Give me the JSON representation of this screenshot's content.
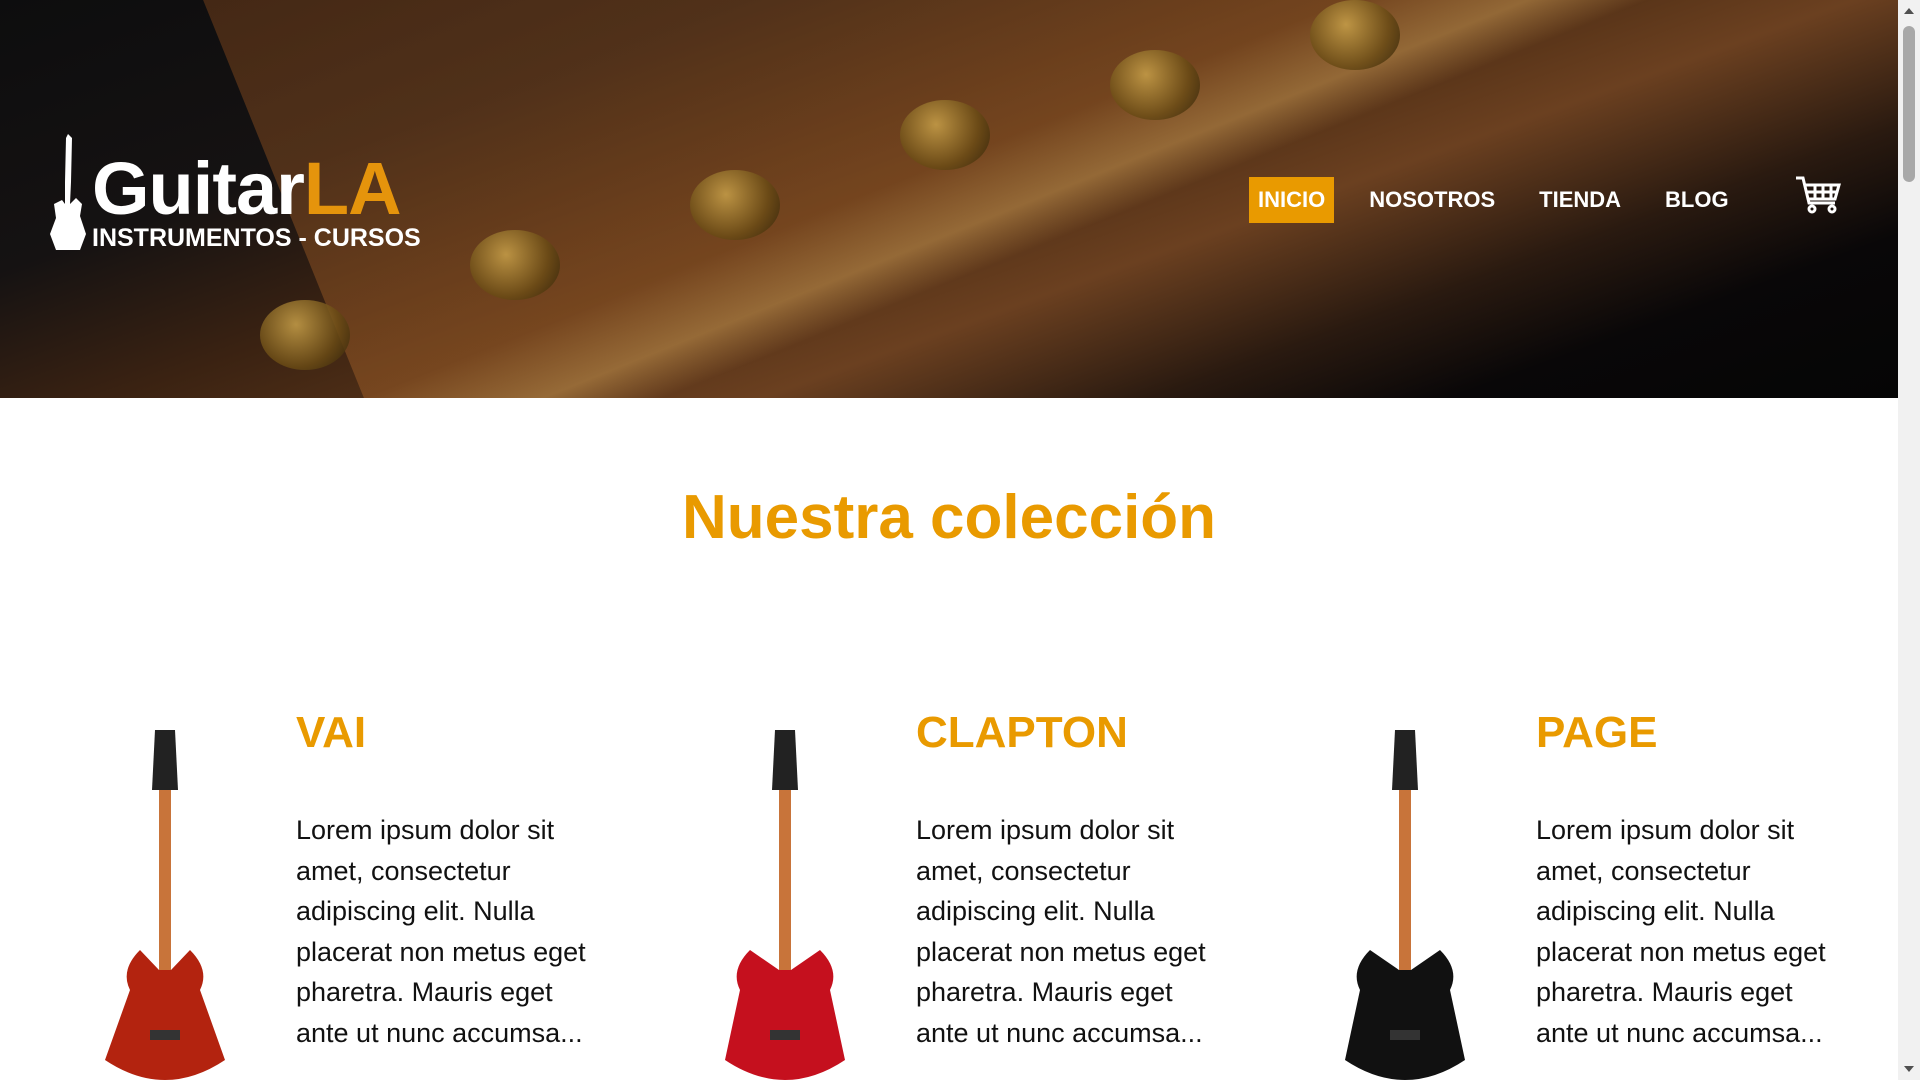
{
  "header": {
    "logo": {
      "brand": "Guitar",
      "brand_accent": "LA",
      "tagline": "INSTRUMENTOS - CURSOS"
    },
    "nav": [
      {
        "label": "INICIO",
        "active": true
      },
      {
        "label": "NOSOTROS"
      },
      {
        "label": "TIENDA"
      },
      {
        "label": "BLOG"
      }
    ],
    "cart_icon": "shopping-cart-icon"
  },
  "colors": {
    "accent": "#e99a00"
  },
  "main": {
    "title": "Nuestra colección",
    "products": [
      {
        "name": "VAI",
        "description": "Lorem ipsum dolor sit amet, consectetur adipiscing elit. Nulla placerat non metus eget pharetra. Mauris eget ante ut nunc accumsa...",
        "guitar_color": "#b3230f"
      },
      {
        "name": "CLAPTON",
        "description": "Lorem ipsum dolor sit amet, consectetur adipiscing elit. Nulla placerat non metus eget pharetra. Mauris eget ante ut nunc accumsa...",
        "guitar_color": "#c5101e"
      },
      {
        "name": "PAGE",
        "description": "Lorem ipsum dolor sit amet, consectetur adipiscing elit. Nulla placerat non metus eget pharetra. Mauris eget ante ut nunc accumsa...",
        "guitar_color": "#111111"
      }
    ]
  }
}
